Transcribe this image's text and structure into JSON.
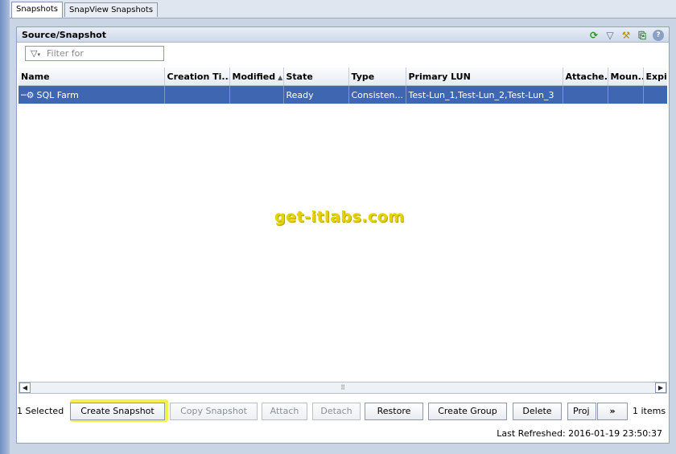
{
  "tabs": [
    {
      "label": "Snapshots"
    },
    {
      "label": "SnapView Snapshots"
    }
  ],
  "panel": {
    "title": "Source/Snapshot"
  },
  "header_icons": [
    "refresh-icon",
    "filter-icon",
    "tools-icon",
    "export-icon",
    "help-icon"
  ],
  "filter": {
    "placeholder": "Filter for"
  },
  "table": {
    "columns": [
      "Name",
      "Creation Ti...",
      "Modified",
      "State",
      "Type",
      "Primary LUN",
      "Attache...",
      "Moun...",
      "Expi"
    ],
    "rows": [
      {
        "name": "SQL Farm",
        "creation": "",
        "modified": "",
        "state": "Ready",
        "type": "Consisten...",
        "primary_lun": "Test-Lun_1,Test-Lun_2,Test-Lun_3",
        "attached": "",
        "mounted": "",
        "expires": ""
      }
    ]
  },
  "watermark": "get-itlabs.com",
  "actions": {
    "selected_count": "1 Selected",
    "create_snapshot": "Create Snapshot",
    "copy_snapshot": "Copy Snapshot",
    "attach": "Attach",
    "detach": "Detach",
    "restore": "Restore",
    "create_group": "Create Group",
    "delete": "Delete",
    "properties": "Proj",
    "more": "»",
    "item_count": "1 items"
  },
  "status": {
    "last_refreshed": "Last Refreshed: 2016-01-19 23:50:37"
  },
  "colors": {
    "selection": "#3f67b1",
    "highlight": "#f2f24a",
    "watermark": "#e6d200"
  }
}
